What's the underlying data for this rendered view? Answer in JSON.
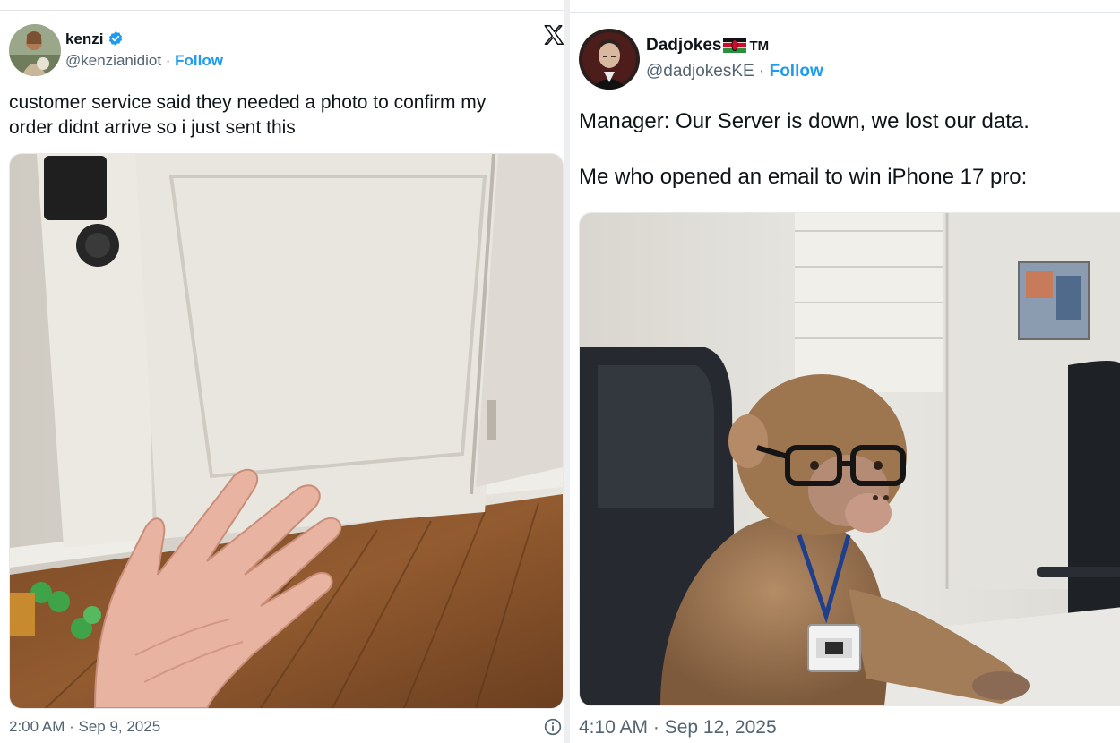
{
  "left_tweet": {
    "display_name": "kenzi",
    "handle": "@kenzianidiot",
    "separator": " · ",
    "follow_label": "Follow",
    "text_line1": "customer service said they needed a photo to confirm my",
    "text_line2": "order didnt arrive so i just sent this",
    "timestamp": "2:00 AM · Sep 9, 2025",
    "verified_icon": "verified-badge-icon",
    "platform_icon": "x-logo-icon",
    "info_icon": "info-icon"
  },
  "right_tweet": {
    "display_name": "Dadjokes",
    "tm": "TM",
    "handle": "@dadjokesKE",
    "separator": " · ",
    "follow_label": "Follow",
    "text_line1": "Manager: Our Server is down, we lost our data.",
    "text_line2": "Me who opened an email to win iPhone 17 pro:",
    "timestamp": "4:10 AM · Sep 12, 2025",
    "flag_icon": "kenya-flag-icon"
  },
  "colors": {
    "accent": "#1d9bf0",
    "secondary_text": "#536471",
    "primary_text": "#0f1419"
  }
}
